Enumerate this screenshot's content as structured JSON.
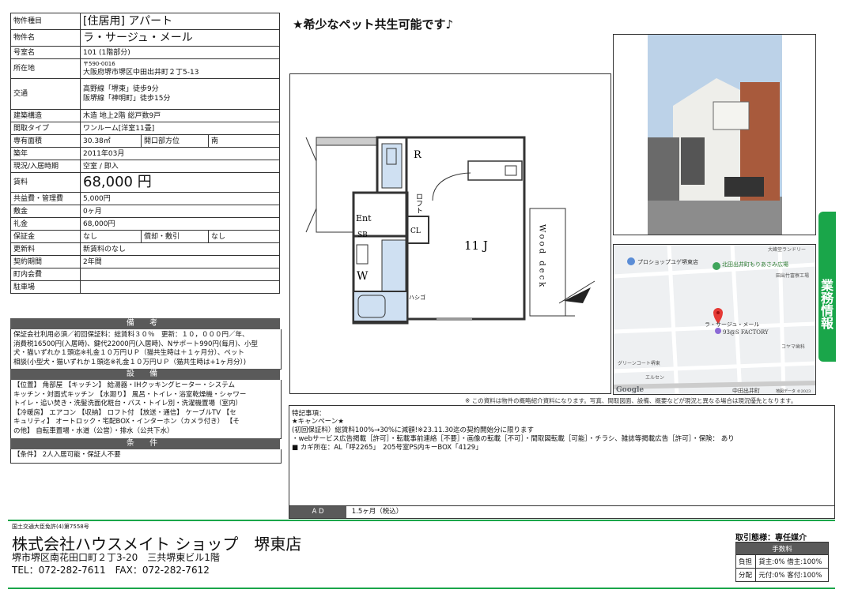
{
  "spec": {
    "type_label": "物件種目",
    "type_value": "[住居用] アパート",
    "name_label": "物件名",
    "name_value": "ラ・サージュ・メール",
    "room_label": "号室名",
    "room_value": "101 (1階部分)",
    "addr_label": "所在地",
    "zip": "〒590-0016",
    "addr": "大阪府堺市堺区中田出井町２丁5-13",
    "access_label": "交通",
    "access1": "高野線「堺東」徒歩9分",
    "access2": "阪堺線「神明町」徒歩15分",
    "struct_label": "建築構造",
    "struct_value": "木造 地上2階 総戸数9戸",
    "layout_label": "間取タイプ",
    "layout_value": "ワンルーム[洋室11畳]",
    "area_label": "専有面積",
    "area_value": "30.38㎡",
    "dir_label": "開口部方位",
    "dir_value": "南",
    "age_label": "築年",
    "age_value": "2011年03月",
    "status_label": "現況/入居時期",
    "status_value": "空室 / 即入",
    "rent_label": "賃料",
    "rent_value": "68,000 円",
    "fee_label": "共益費・管理費",
    "fee_value": "5,000円",
    "shiki_label": "敷金",
    "shiki_value": "0ヶ月",
    "rei_label": "礼金",
    "rei_value": "68,000円",
    "deposit_label": "保証金",
    "deposit_value": "なし",
    "shokyaku_label": "償却・敷引",
    "shokyaku_value": "なし",
    "renew_label": "更新料",
    "renew_value": "新賃料のなし",
    "term_label": "契約期間",
    "term_value": "2年間",
    "town_label": "町内会費",
    "town_value": "",
    "parking_label": "駐車場",
    "parking_value": ""
  },
  "sections": {
    "biko_title": "備 考",
    "biko_text": "保証会社利用必須／初回保証料：総賃料３０％　更新：１０，０００円／年、\n消費税16500円(入居時)、鍵代22000円(入居時)、Nサポート990円(毎月)、小型\n犬・猫いずれか１頭迄※礼金１０万円ＵＰ（猫共生時は＋１ヶ月分）、ペット\n相談(小型犬・猫いずれか１頭迄※礼金１０万円ＵＰ（猫共生時は+1ヶ月分）)",
    "setsubi_title": "設 備",
    "setsubi_text": "【位置】 角部屋 【キッチン】 給湯器・IHクッキングヒーター・システム\nキッチン・対面式キッチン 【水廻り】 風呂・トイレ・浴室乾燥機・シャワー\nトイレ・追い焚き・洗髪洗面化粧台・バス・トイレ別・洗濯機置場（室内）\n【冷暖房】 エアコン 【収納】 ロフト付 【放送・通信】 ケーブルTV 【セ\nキュリティ】 オートロック・宅配BOX・インターホン（カメラ付き） 【そ\nの他】 自転車置場・水道（公営）・排水（公共下水）",
    "joken_title": "条 件",
    "joken_text": "【条件】 2人入居可能・保証人不要"
  },
  "headline": "★希少なペット共生可能です♪",
  "floorplan": {
    "r": "R",
    "loft": "ロフト",
    "ent": "Ent",
    "sb": "SB",
    "cl": "CL",
    "room": "11 J",
    "w": "W",
    "wood": "Wood deck",
    "hashigo": "ハシゴ"
  },
  "side_tab": "業務情報",
  "map": {
    "google": "Google",
    "data": "地図データ ©2023",
    "poi1": "プロショップユゲ堺東店",
    "poi2": "北田出井町もりあさみ広場",
    "poi3": "ラ・サージュ・メール",
    "poi4": "93@S FACTORY",
    "poi5": "田出竹富寮工場",
    "poi6": "コヤマ歯科",
    "poi7": "グリーンコート堺東",
    "poi8": "中田出井町",
    "poi9": "大峰堂ランドリー",
    "poi10": "エルセン"
  },
  "note": "※ この資料は物件の概略紹介資料になります。写真、間取図面、設備、概要などが現況と異なる場合は現況優先となります。",
  "special": {
    "title": "特記事項：",
    "text": "★キャンペーン★\n(初回保証料）総賃料100%→30%に減額!※23.11.30迄の契約開始分に限ります\n・webサービス広告掲載［許可］・転載事前連絡［不要］・画像の転載［不可］・間取図転載［可能］・チラシ、雑誌等掲載広告［許可］・保険： あり\n■ カギ所在：AL「呼2265」　205号室PS内キーBOX「4129」",
    "ad_label": "A D",
    "ad_value": "1.5ヶ月（税込）"
  },
  "footer": {
    "license": "国土交通大臣免許(4)第7558号",
    "company": "株式会社ハウスメイト ショップ　堺東店",
    "address": "堺市堺区南花田口町２丁3-20　三共堺東ビル1階",
    "tel": "TEL：072-282-7611　FAX：072-282-7612",
    "torihiki": "取引態様：専任媒介",
    "commission_title": "手数料",
    "futan_label": "負担",
    "futan_value": "貸主:0% 借主:100%",
    "bunpai_label": "分配",
    "bunpai_value": "元付:0% 客付:100%"
  },
  "colors": {
    "accent_green": "#1aa64a",
    "header_gray": "#5a5a5a",
    "map_marker": "#e53935"
  }
}
